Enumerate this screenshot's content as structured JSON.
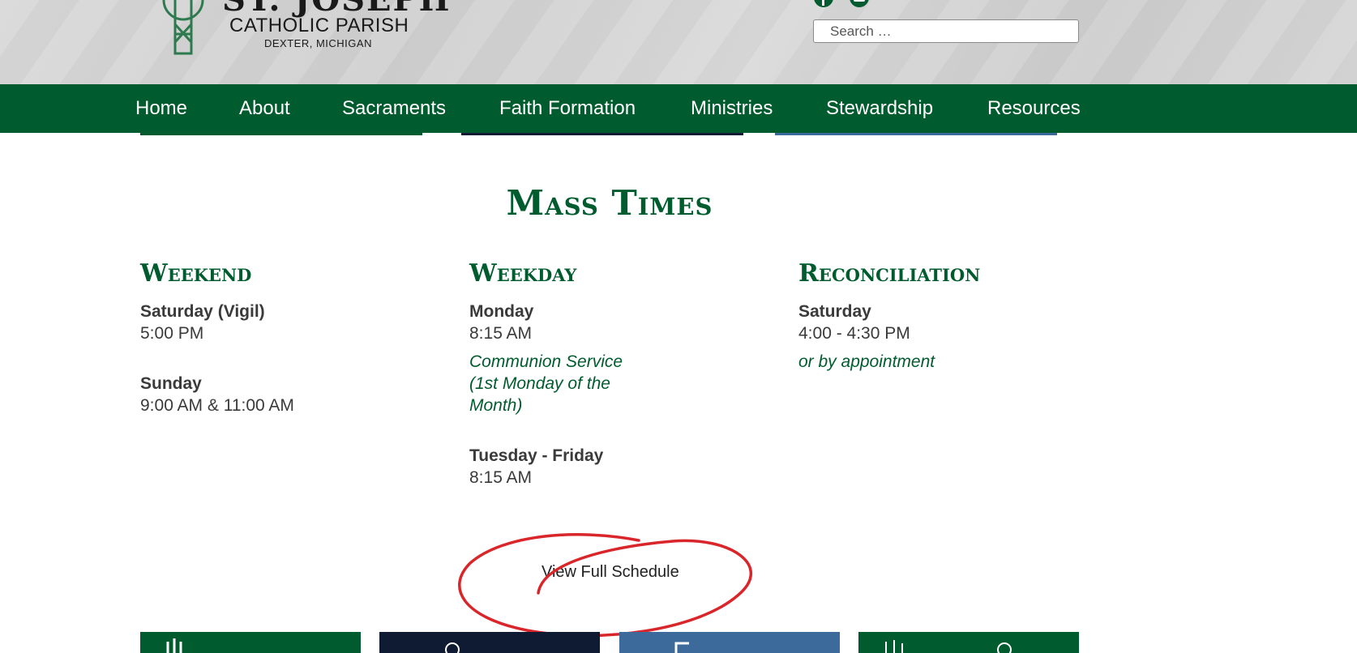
{
  "header": {
    "logo_title": "ST. JOSEPH",
    "logo_subtitle": "CATHOLIC PARISH",
    "logo_location": "DEXTER, MICHIGAN",
    "social_icons": [
      "facebook-icon",
      "youtube-icon"
    ],
    "search_placeholder": "Search …"
  },
  "nav": {
    "items": [
      {
        "label": "Home"
      },
      {
        "label": "About"
      },
      {
        "label": "Sacraments"
      },
      {
        "label": "Faith Formation"
      },
      {
        "label": "Ministries"
      },
      {
        "label": "Stewardship"
      },
      {
        "label": "Resources"
      }
    ]
  },
  "main": {
    "title": "Mass Times",
    "weekend": {
      "heading": "Weekend",
      "entries": [
        {
          "day": "Saturday (Vigil)",
          "time": "5:00 PM"
        },
        {
          "day": "Sunday",
          "time": "9:00 AM & 11:00 AM"
        }
      ]
    },
    "weekday": {
      "heading": "Weekday",
      "entries": [
        {
          "day": "Monday",
          "time": "8:15 AM",
          "note": "Communion Service (1st Monday of the Month)"
        },
        {
          "day": "Tuesday - Friday",
          "time": "8:15 AM"
        }
      ]
    },
    "reconciliation": {
      "heading": "Reconciliation",
      "entries": [
        {
          "day": "Saturday",
          "time": "4:00 - 4:30 PM",
          "note": "or by appointment"
        }
      ]
    },
    "view_link": "View Full Schedule"
  },
  "colors": {
    "brand_green": "#005c2e",
    "navy": "#0f1a33",
    "steel_blue": "#3c6a9a",
    "annotation_red": "#d9262b"
  }
}
